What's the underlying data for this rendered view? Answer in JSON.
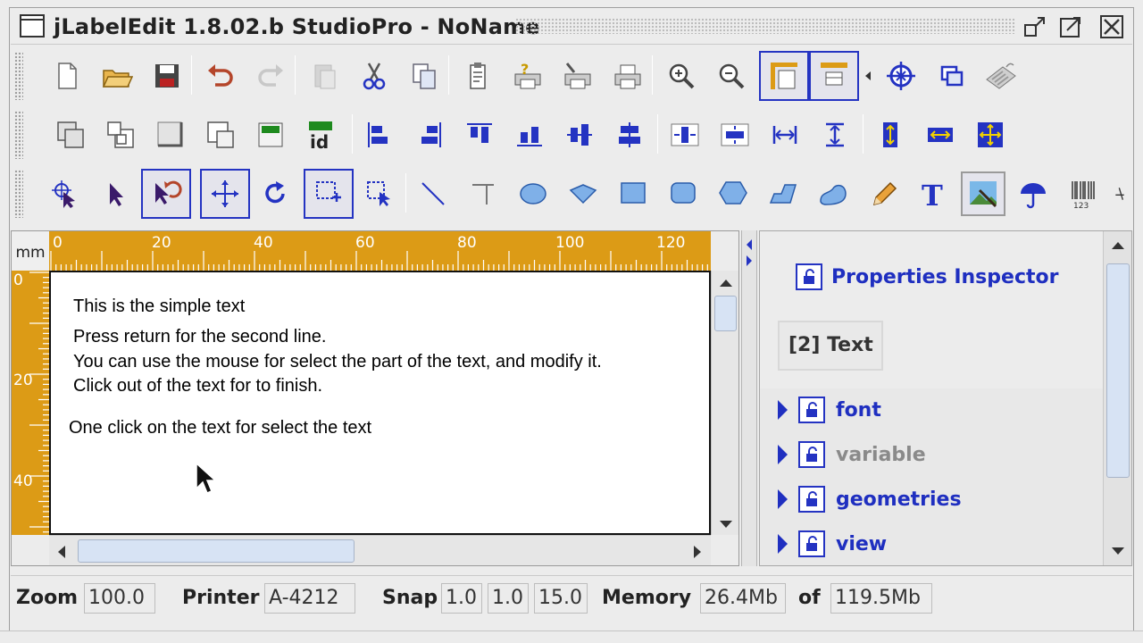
{
  "window": {
    "title": "jLabelEdit 1.8.02.b StudioPro - NoName"
  },
  "toolbar1": [
    "new-file-icon",
    "open-folder-icon",
    "save-icon",
    "undo-icon",
    "redo-icon",
    "paste-icon",
    "cut-icon",
    "copy-icon",
    "properties-icon",
    "print-help-icon",
    "print-setup-icon",
    "print-icon",
    "zoom-in-icon",
    "zoom-out-icon",
    "page-layout-icon",
    "label-layout-icon",
    "crosshair-icon",
    "window-icon",
    "keyboard-icon"
  ],
  "toolbar2": [
    "bring-front-icon",
    "send-back-icon",
    "move-up-icon",
    "move-down-icon",
    "counter-icon",
    "id-icon",
    "align-left-icon",
    "align-right-icon",
    "align-top-icon",
    "align-bottom-icon",
    "align-center-h-icon",
    "align-center-v-icon",
    "center-horizontal-icon",
    "center-vertical-icon",
    "distribute-h-icon",
    "distribute-v-icon",
    "same-height-icon",
    "same-width-icon",
    "same-size-icon"
  ],
  "toolbar3": [
    "select-pointer-icon",
    "arrow-pointer-icon",
    "rotate-pointer-icon",
    "move-icon",
    "rotate-icon",
    "resize-select-icon",
    "node-edit-icon",
    "line-icon",
    "corner-line-icon",
    "ellipse-icon",
    "diamond-icon",
    "rectangle-icon",
    "rounded-rect-icon",
    "polygon-icon",
    "parallelogram-icon",
    "blob-icon",
    "pencil-icon",
    "text-icon",
    "image-icon",
    "umbrella-icon",
    "barcode-icon"
  ],
  "ruler": {
    "unit": "mm",
    "h_labels": [
      "0",
      "20",
      "40",
      "60",
      "80",
      "100",
      "120"
    ],
    "v_labels": [
      "0",
      "20",
      "40"
    ]
  },
  "document": {
    "lines": [
      "This is the simple text",
      "Press return for the second line.",
      "You can use the mouse for select the part of the text, and modify it.",
      "Click out of the text for to finish.",
      "One click on the text for select the text"
    ]
  },
  "properties": {
    "title": "Properties Inspector",
    "selected": "[2] Text",
    "groups": [
      {
        "label": "font",
        "enabled": true
      },
      {
        "label": "variable",
        "enabled": false
      },
      {
        "label": "geometries",
        "enabled": true
      },
      {
        "label": "view",
        "enabled": true
      }
    ]
  },
  "status": {
    "zoom_label": "Zoom",
    "zoom": "100.0",
    "printer_label": "Printer",
    "printer": "A-4212",
    "snap_label": "Snap",
    "snap_x": "1.0",
    "snap_y": "1.0",
    "snap_angle": "15.0",
    "memory_label": "Memory",
    "memory_used": "26.4Mb",
    "of_label": "of",
    "memory_total": "119.5Mb"
  },
  "colors": {
    "accent": "#1f2fc0",
    "ruler": "#dc9b16",
    "selected_border": "#2433c2"
  }
}
